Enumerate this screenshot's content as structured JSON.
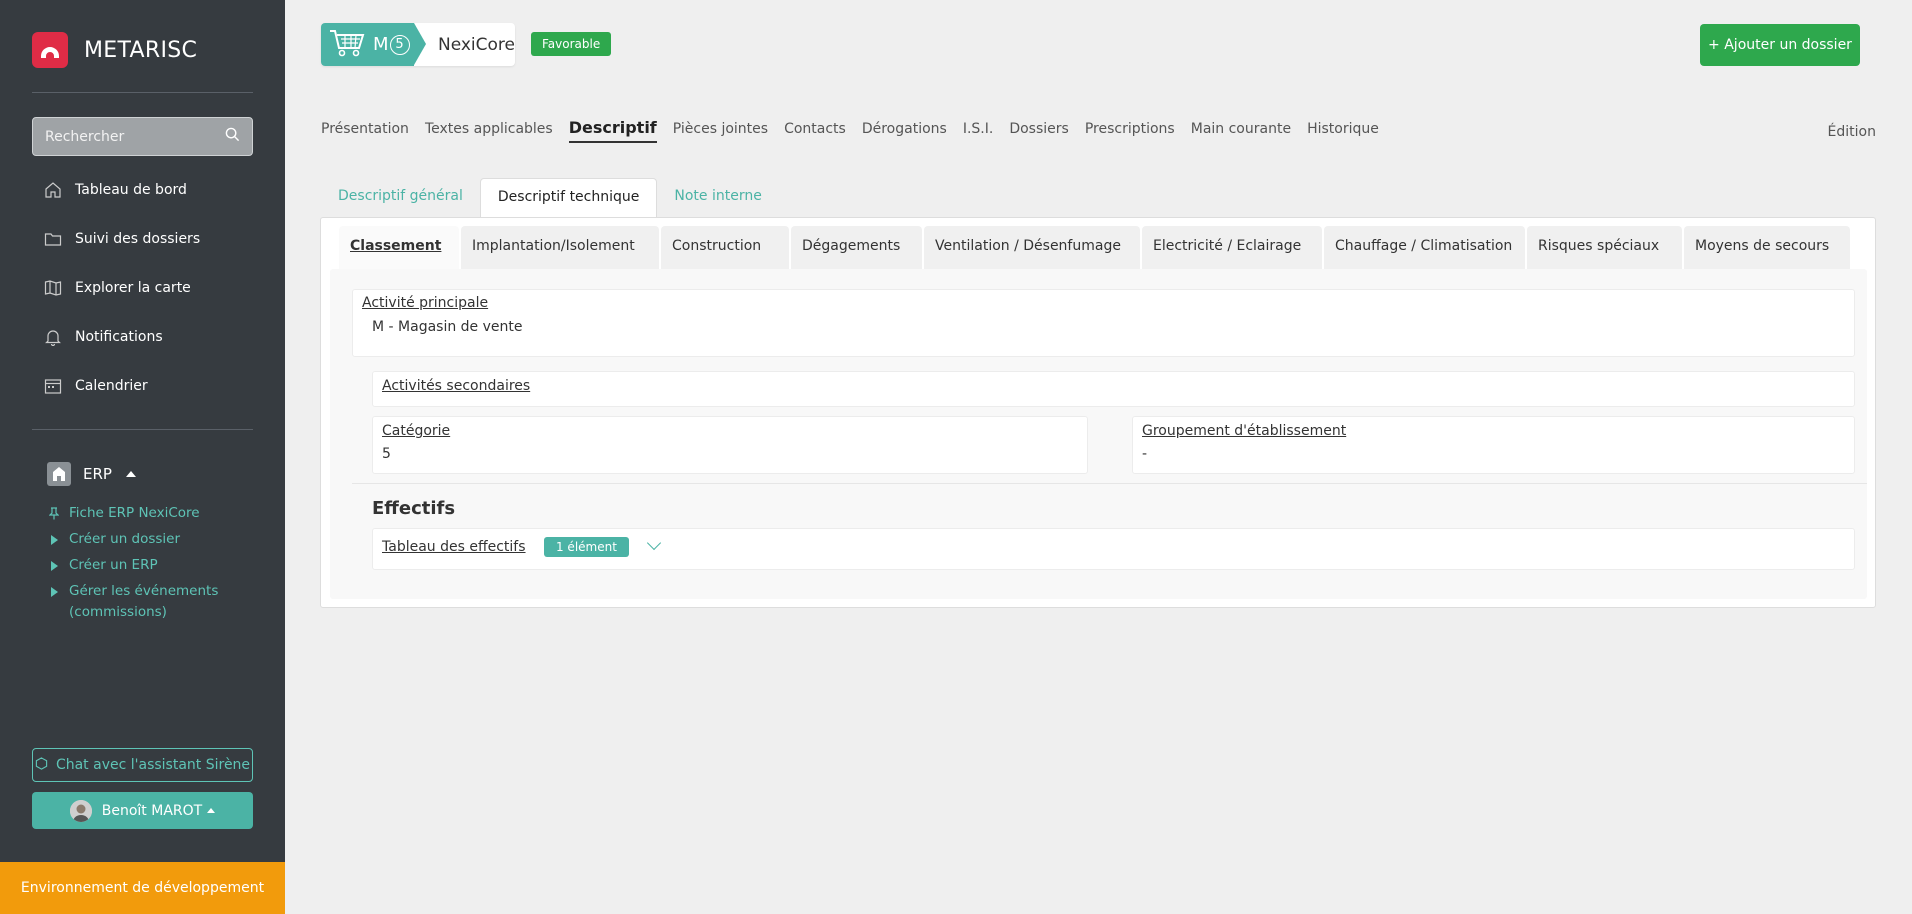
{
  "app": {
    "name": "METARISC"
  },
  "sidebar": {
    "search_placeholder": "Rechercher",
    "nav": [
      {
        "label": "Tableau de bord",
        "icon": "home-icon"
      },
      {
        "label": "Suivi des dossiers",
        "icon": "folder-icon"
      },
      {
        "label": "Explorer la carte",
        "icon": "map-icon"
      },
      {
        "label": "Notifications",
        "icon": "bell-icon"
      },
      {
        "label": "Calendrier",
        "icon": "calendar-icon"
      }
    ],
    "erp_section": {
      "label": "ERP",
      "items": [
        {
          "label": "Fiche ERP NexiCore",
          "marker": "pin-icon"
        },
        {
          "label": "Créer un dossier",
          "marker": "play-icon"
        },
        {
          "label": "Créer un ERP",
          "marker": "play-icon"
        },
        {
          "label": "Gérer les événements",
          "label2": "(commissions)",
          "marker": "play-icon"
        }
      ]
    },
    "chat_label": "Chat avec l'assistant Sirène",
    "user_name": "Benoît MAROT",
    "env_label": "Environnement de développement"
  },
  "header": {
    "erp_code": "M",
    "erp_category": "5",
    "erp_name": "NexiCore",
    "avis_tag": "Favorable",
    "add_button": "+ Ajouter un dossier"
  },
  "main_tabs": [
    "Présentation",
    "Textes applicables",
    "Descriptif",
    "Pièces jointes",
    "Contacts",
    "Dérogations",
    "I.S.I.",
    "Dossiers",
    "Prescriptions",
    "Main courante",
    "Historique"
  ],
  "active_main_tab": "Descriptif",
  "edition_label": "Édition",
  "sub_tabs": [
    "Descriptif général",
    "Descriptif technique",
    "Note interne"
  ],
  "active_sub_tab": "Descriptif technique",
  "classement_tabs": [
    "Classement",
    "Implantation/Isolement",
    "Construction",
    "Dégagements",
    "Ventilation / Désenfumage",
    "Electricité / Eclairage",
    "Chauffage / Climatisation",
    "Risques spéciaux",
    "Moyens de secours"
  ],
  "active_classement_tab": "Classement",
  "classement": {
    "activite_principale_label": "Activité principale",
    "activite_principale_value": "M - Magasin de vente",
    "activites_secondaires_label": "Activités secondaires",
    "categorie_label": "Catégorie",
    "categorie_value": "5",
    "groupement_label": "Groupement d'établissement",
    "groupement_value": "-",
    "effectifs_title": "Effectifs",
    "tableau_effectifs_label": "Tableau des effectifs",
    "tableau_effectifs_count": "1 élément"
  },
  "colors": {
    "sidebar_bg": "#363b40",
    "accent": "#4bb3a5",
    "brand_red": "#e02c46",
    "success": "#2ea84d",
    "env_orange": "#f29b0c"
  }
}
